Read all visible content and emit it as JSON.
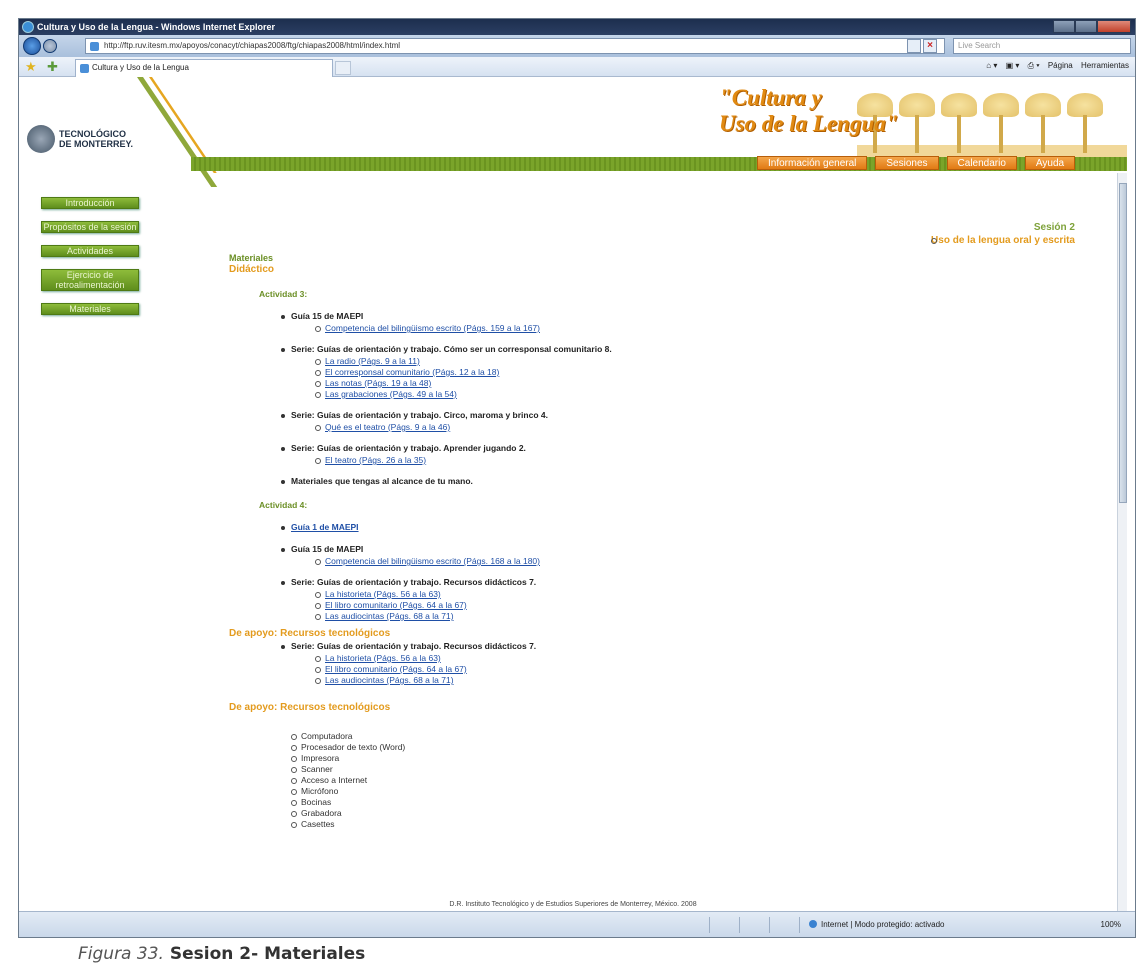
{
  "window": {
    "title": "Cultura y Uso de la Lengua - Windows Internet Explorer",
    "address": "http://ftp.ruv.itesm.mx/apoyos/conacyt/chiapas2008/ftg/chiapas2008/html/index.html",
    "search_placeholder": "Live Search",
    "tab_label": "Cultura y Uso de la Lengua",
    "commands": [
      "Página",
      "Herramientas"
    ]
  },
  "site": {
    "logo_line1": "TECNOLÓGICO",
    "logo_line2": "DE MONTERREY.",
    "brand_line1": "\"Cultura y",
    "brand_line2": "Uso de la Lengua\"",
    "nav": [
      "Información general",
      "Sesiones",
      "Calendario",
      "Ayuda"
    ],
    "left_menu": [
      "Introducción",
      "Propósitos de la sesión",
      "Actividades",
      "Ejercicio de retroalimentación",
      "Materiales"
    ],
    "session_title": "Sesión 2",
    "session_subtitle": "Uso de la lengua oral y escrita"
  },
  "content": {
    "materiales": "Materiales",
    "didactico": "Didáctico",
    "actividad3": {
      "label": "Actividad 3:",
      "groups": [
        {
          "title": "Guía 15 de MAEPI",
          "links": [
            "Competencia del bilingüismo escrito (Págs. 159 a la 167)"
          ]
        },
        {
          "title": "Serie: Guías de orientación y trabajo. Cómo ser un corresponsal comunitario 8.",
          "links": [
            "La radio (Págs. 9 a la 11)",
            "El corresponsal comunitario (Págs. 12 a la 18)",
            "Las notas (Págs. 19 a la 48)",
            "Las grabaciones (Págs. 49 a la 54)"
          ]
        },
        {
          "title": "Serie: Guías de orientación y trabajo. Circo, maroma y brinco 4.",
          "links": [
            "Qué es el teatro (Págs. 9 a la 46)"
          ]
        },
        {
          "title": "Serie: Guías de orientación y trabajo. Aprender jugando 2.",
          "links": [
            "El teatro (Págs. 26 a la 35)"
          ]
        },
        {
          "title": "Materiales que tengas al alcance de tu mano.",
          "links": []
        }
      ]
    },
    "actividad4": {
      "label": "Actividad 4:",
      "link_item": "Guía 1 de MAEPI",
      "groups": [
        {
          "title": "Guía 15 de MAEPI",
          "links": [
            "Competencia del bilingüismo escrito (Págs. 168 a la 180)"
          ]
        },
        {
          "title": "Serie: Guías de orientación y trabajo. Recursos didácticos 7.",
          "links": [
            "La historieta (Págs. 56 a la 63)",
            "El libro comunitario (Págs. 64 a la 67)",
            "Las audiocintas (Págs. 68 a la 71)"
          ]
        }
      ]
    },
    "apoyo1": {
      "label": "De apoyo: Recursos tecnológicos",
      "group": {
        "title": "Serie: Guías de orientación y trabajo. Recursos didácticos 7.",
        "links": [
          "La historieta (Págs. 56 a la 63)",
          "El libro comunitario (Págs. 64 a la 67)",
          "Las audiocintas (Págs. 68 a la 71)"
        ]
      }
    },
    "apoyo2": {
      "label": "De apoyo: Recursos tecnológicos",
      "items": [
        "Computadora",
        "Procesador de texto (Word)",
        "Impresora",
        "Scanner",
        "Acceso a Internet",
        "Micrófono",
        "Bocinas",
        "Grabadora",
        "Casettes"
      ]
    },
    "footer": "D.R. Instituto Tecnológico y de Estudios Superiores de Monterrey, México. 2008"
  },
  "status": {
    "zone": "Internet | Modo protegido: activado",
    "zoom": "100%"
  },
  "caption": {
    "figure": "Figura 33.",
    "text": "Sesion 2- Materiales"
  }
}
